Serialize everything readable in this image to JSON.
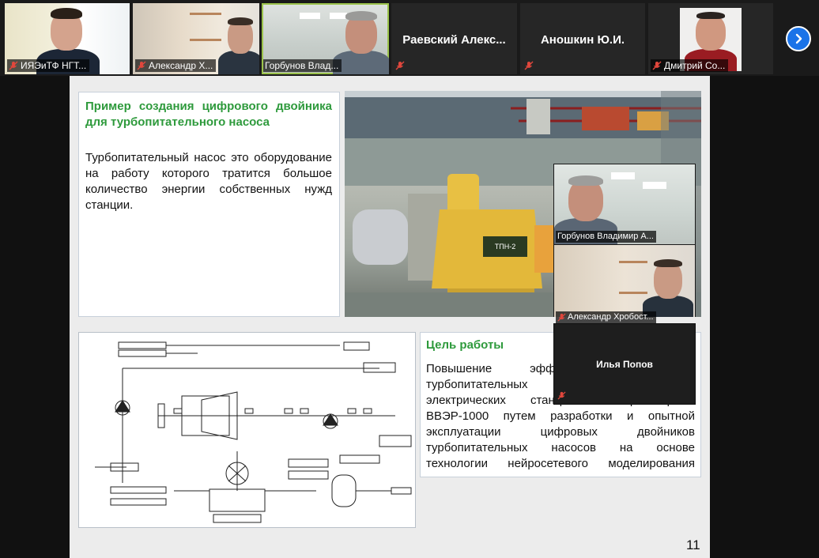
{
  "participants": [
    {
      "name": "ИЯЭиТФ НГТ...",
      "muted": true
    },
    {
      "name": "Александр Х...",
      "muted": true
    },
    {
      "name": "Горбунов Влад...",
      "muted": false,
      "active": true
    },
    {
      "name": "Раевский Алекс...",
      "muted": true,
      "no_video": true
    },
    {
      "name": "Аношкин Ю.И.",
      "muted": true,
      "no_video": true
    },
    {
      "name": "Дмитрий Со...",
      "muted": true
    }
  ],
  "next_icon": "chevron-right-icon",
  "slide": {
    "intro_title": "Пример создания цифрового двойника для турбопитательного насоса",
    "intro_body": "Турбопитательный насос это оборудование на работу которого тратится большое количество энергии собственных нужд станции.",
    "goal_title": "Цель работы",
    "goal_body": "Повышение эффективности работы турбопитательных насосов атомных электрических станций с реакторами ВВЭР-1000 путем разработки и опытной эксплуатации цифровых двойников турбопитательных насосов на основе технологии нейросетевого моделирования",
    "photo_label": "ТПН-2",
    "page_number": "11"
  },
  "floating_participants": [
    {
      "name": "Горбунов Владимир А...",
      "muted": false
    },
    {
      "name": "Александр Хробост...",
      "muted": true
    },
    {
      "name": "Илья Попов",
      "muted": true,
      "no_video": true
    }
  ],
  "colors": {
    "accent_green": "#2e9a3c",
    "active_border": "#9bc34b",
    "next_button": "#1a73e8",
    "mic_off": "#e0473c"
  }
}
